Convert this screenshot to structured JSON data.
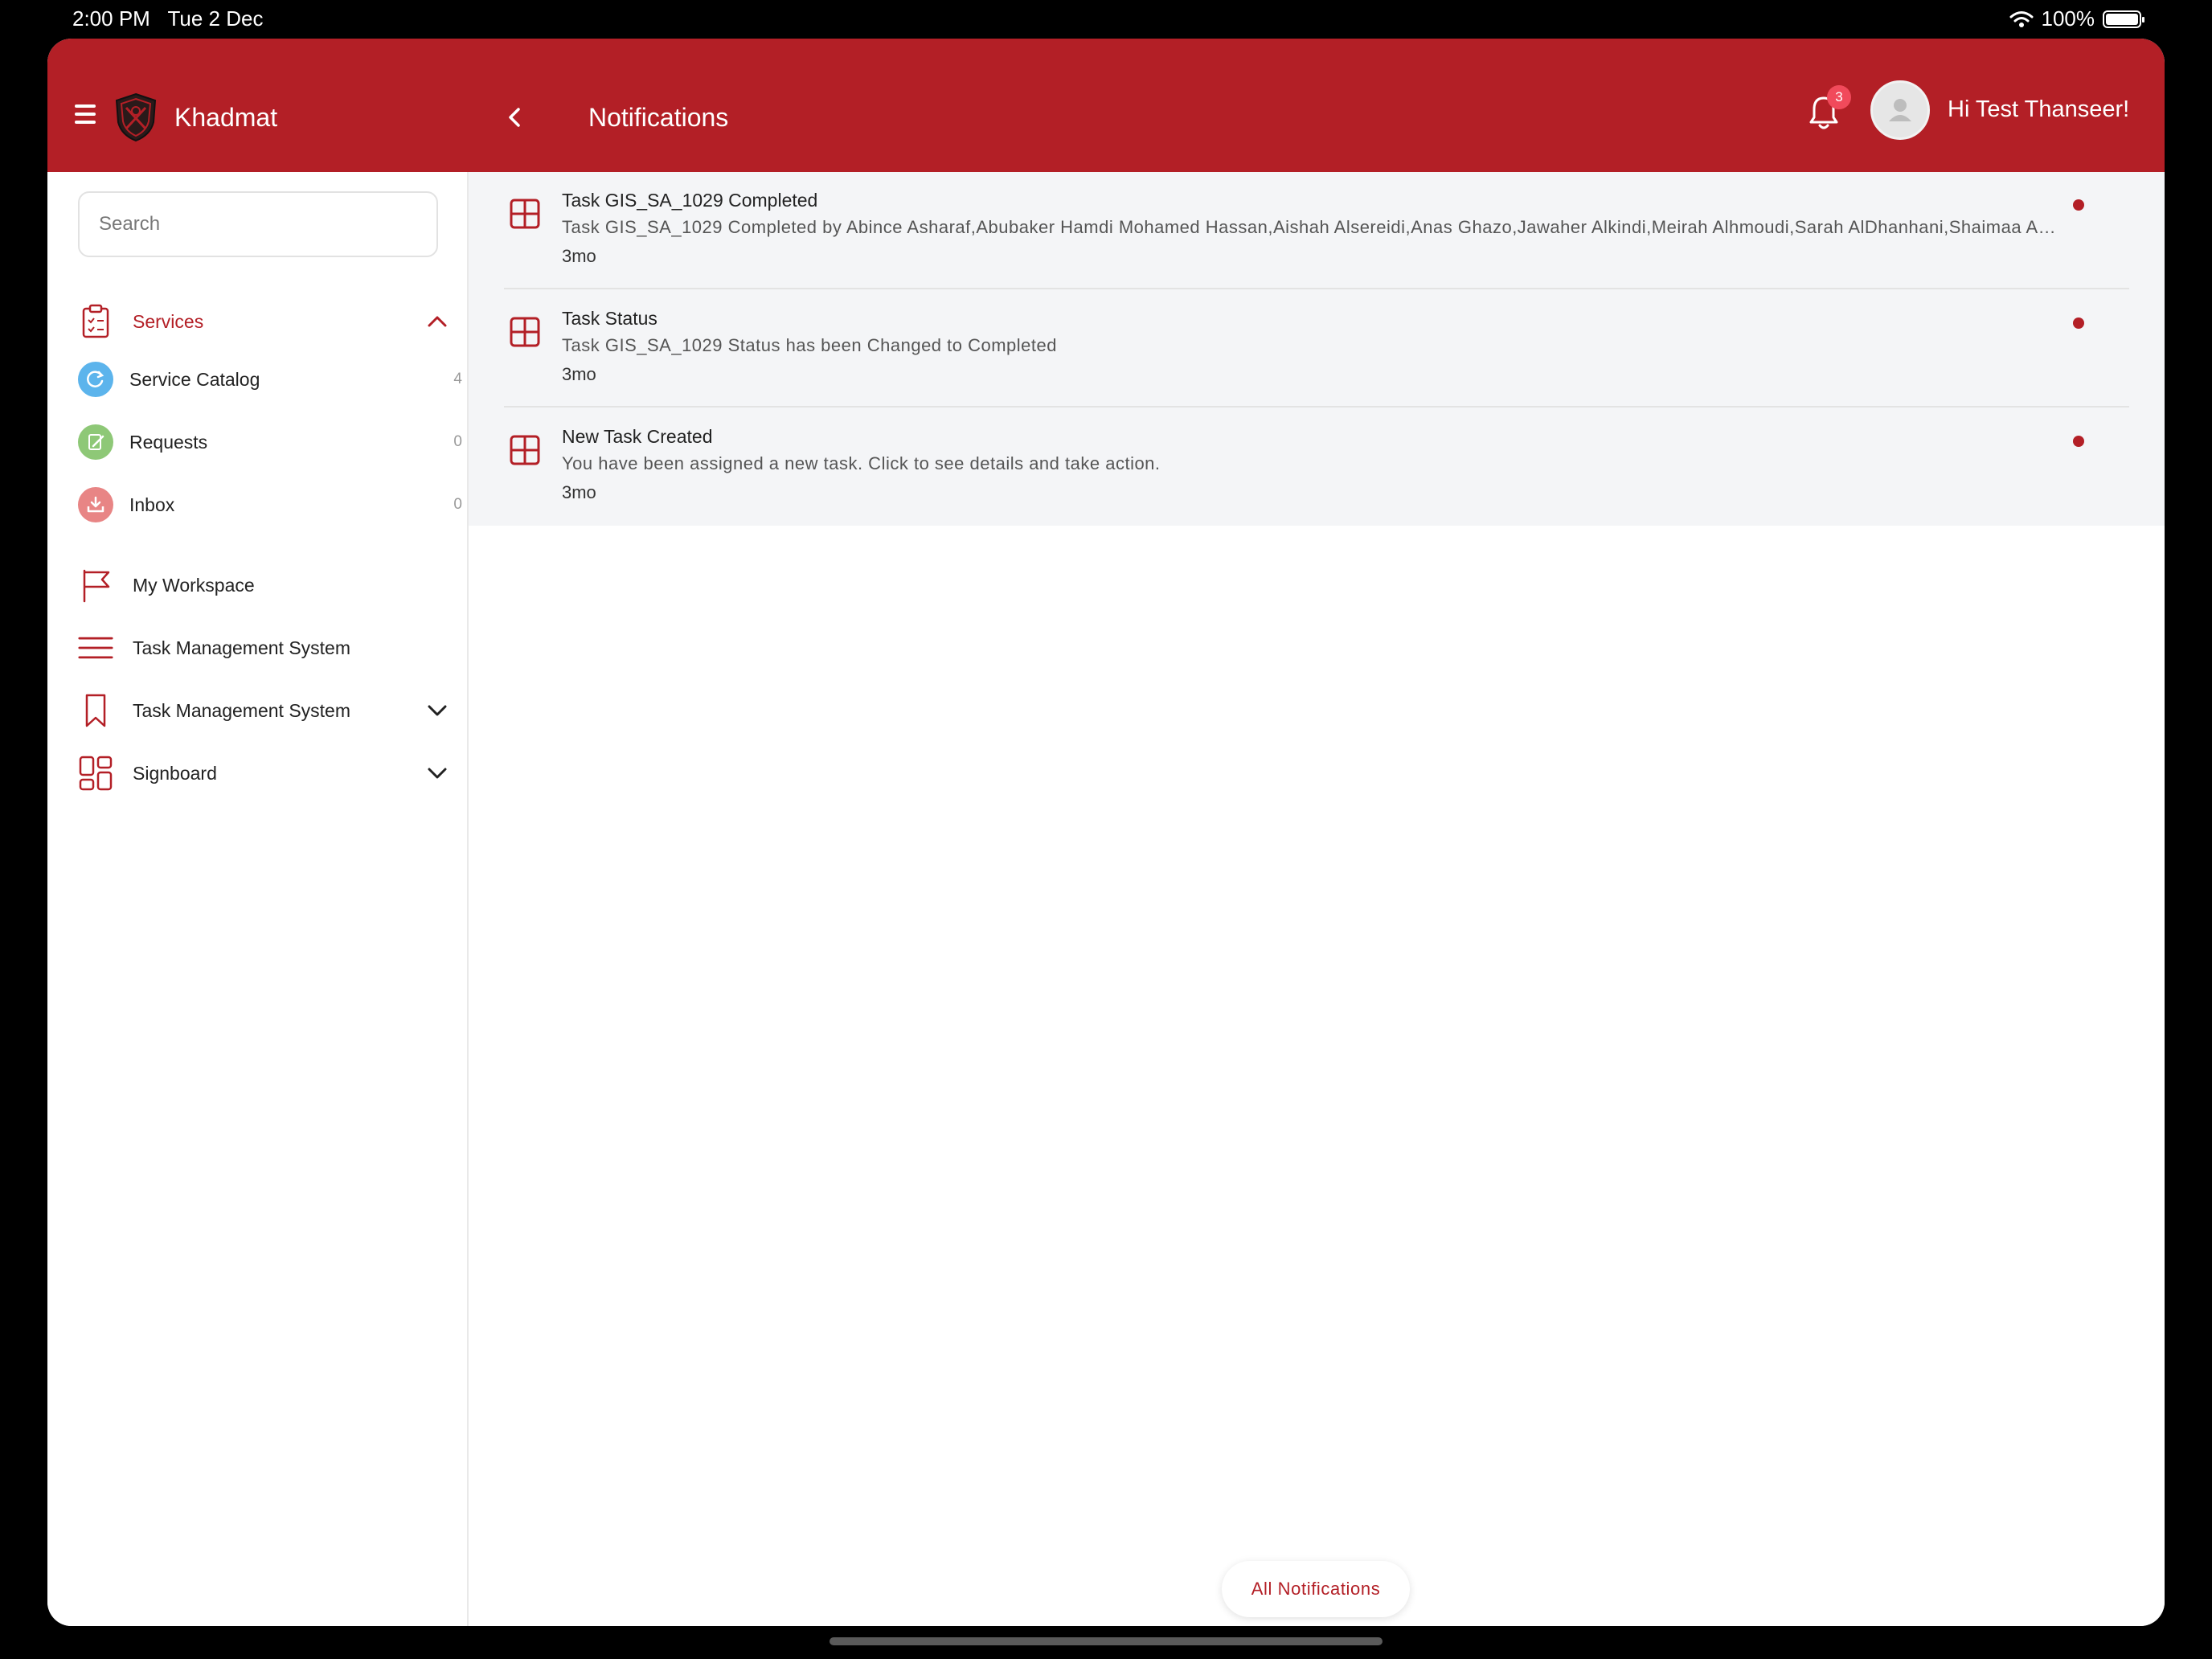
{
  "status_bar": {
    "time": "2:00 PM",
    "date": "Tue 2 Dec",
    "battery": "100%"
  },
  "header": {
    "app_title": "Khadmat",
    "page_title": "Notifications",
    "notification_count": "3",
    "greeting": "Hi Test Thanseer!"
  },
  "sidebar": {
    "search_placeholder": "Search",
    "services_label": "Services",
    "sub_items": [
      {
        "label": "Service Catalog",
        "count": "4"
      },
      {
        "label": "Requests",
        "count": "0"
      },
      {
        "label": "Inbox",
        "count": "0"
      }
    ],
    "items": [
      {
        "label": "My Workspace"
      },
      {
        "label": "Task Management System"
      },
      {
        "label": "Task Management System"
      },
      {
        "label": "Signboard"
      }
    ]
  },
  "notifications": [
    {
      "title": "Task GIS_SA_1029 Completed",
      "body": "Task GIS_SA_1029 Completed by Abince Asharaf,Abubaker  Hamdi  Mohamed Hassan,Aishah Alsereidi,Anas Ghazo,Jawaher Alkindi,Meirah Alhmoudi,Sarah AlDhanhani,Shaimaa Al...",
      "time": "3mo"
    },
    {
      "title": "Task Status",
      "body": "Task GIS_SA_1029 Status has been Changed to Completed",
      "time": "3mo"
    },
    {
      "title": "New Task Created",
      "body": "You have been assigned a new task. Click to see details and take action.",
      "time": "3mo"
    }
  ],
  "all_notifications_label": "All Notifications",
  "colors": {
    "brand": "#b31f26",
    "badge": "#f14a5b",
    "panel": "#f4f5f7"
  }
}
